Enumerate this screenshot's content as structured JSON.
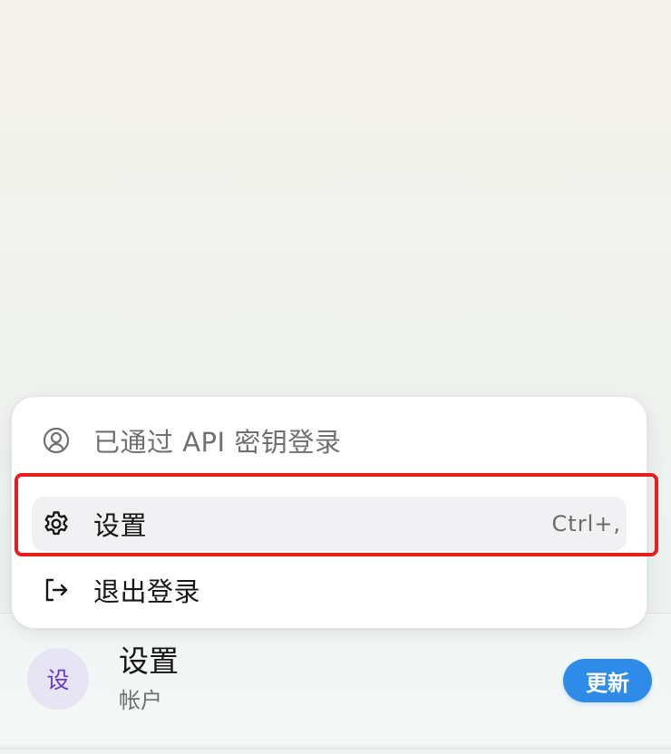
{
  "menu": {
    "items": [
      {
        "icon": "user-circle-icon",
        "label": "已通过 API 密钥登录"
      },
      {
        "icon": "gear-icon",
        "label": "设置",
        "shortcut": "Ctrl+,"
      },
      {
        "icon": "logout-icon",
        "label": "退出登录"
      }
    ]
  },
  "profile": {
    "avatar_text": "设",
    "name": "设置",
    "subtitle": "帐户",
    "update_label": "更新"
  },
  "colors": {
    "highlight": "#e31f1f",
    "update_button": "#2e8be7",
    "avatar_bg": "#e7e4f3",
    "avatar_text": "#6a3ac9"
  }
}
